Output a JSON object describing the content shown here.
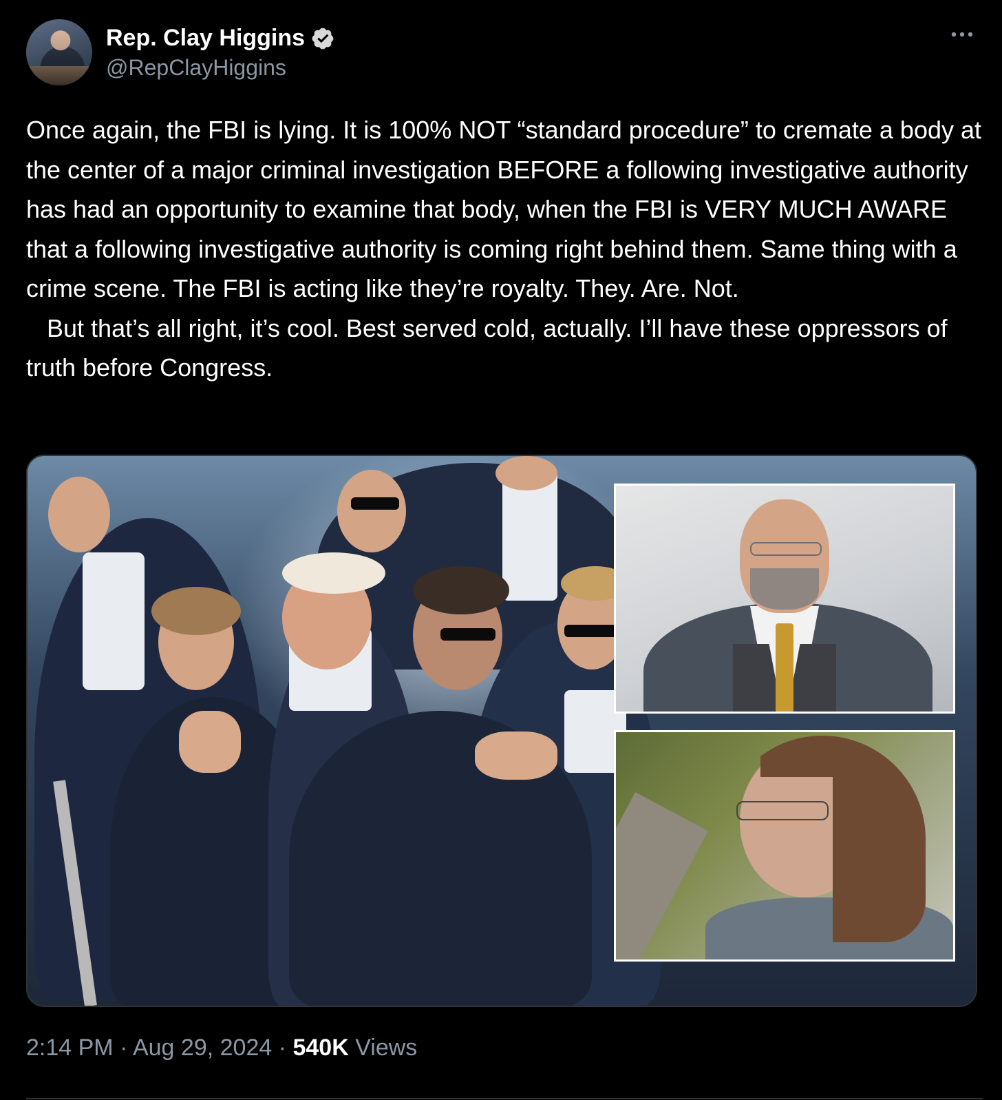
{
  "author": {
    "name": "Rep. Clay Higgins",
    "handle": "@RepClayHiggins",
    "verified": true,
    "avatar_icon": "profile-photo"
  },
  "menu": {
    "more_icon": "ellipsis-icon"
  },
  "tweet": {
    "paragraphs": [
      "Once again, the FBI is lying. It is 100% NOT “standard procedure” to cremate a body at the center of a major criminal investigation BEFORE a following investigative authority has had an opportunity to examine that body, when the FBI is VERY MUCH AWARE that a following investigative authority is coming right behind them. Same thing with a crime scene. The FBI is acting like they’re royalty. They. Are. Not.",
      "   But that’s all right, it’s cool. Best served cold, actually. I’ll have these oppressors of truth before Congress."
    ]
  },
  "media": {
    "type": "photo",
    "insets": 2
  },
  "meta": {
    "time": "2:14 PM",
    "separator": " · ",
    "date": "Aug 29, 2024",
    "views_count": "540K",
    "views_label": " Views"
  },
  "colors": {
    "background": "#000000",
    "text": "#ffffff",
    "secondary": "#8b98a5",
    "verified": "#e7e9ea",
    "divider": "#2f3336"
  }
}
